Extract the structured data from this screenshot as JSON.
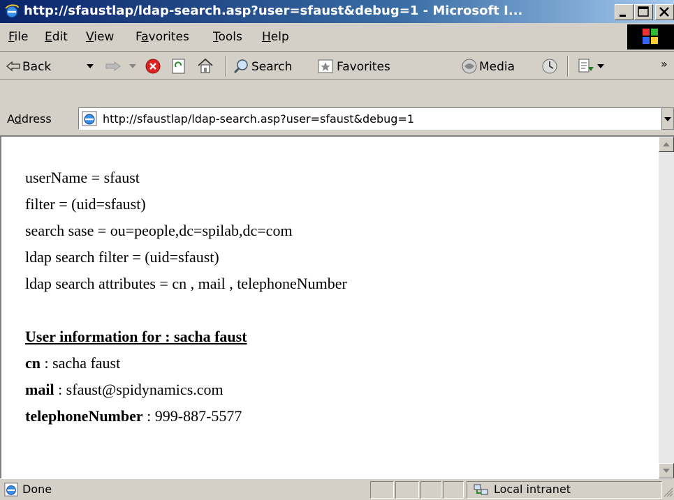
{
  "window": {
    "title": "http://sfaustlap/ldap-search.asp?user=sfaust&debug=1 - Microsoft I..."
  },
  "menu": {
    "file": {
      "pre": "",
      "u": "F",
      "post": "ile"
    },
    "edit": {
      "pre": "",
      "u": "E",
      "post": "dit"
    },
    "view": {
      "pre": "",
      "u": "V",
      "post": "iew"
    },
    "favorites": {
      "pre": "F",
      "u": "a",
      "post": "vorites"
    },
    "tools": {
      "pre": "",
      "u": "T",
      "post": "ools"
    },
    "help": {
      "pre": "",
      "u": "H",
      "post": "elp"
    }
  },
  "toolbar": {
    "back": "Back",
    "search": "Search",
    "favorites": "Favorites",
    "media": "Media",
    "more": "»"
  },
  "address": {
    "label_pre": "A",
    "label_u": "d",
    "label_post": "dress",
    "url": "http://sfaustlap/ldap-search.asp?user=sfaust&debug=1"
  },
  "content": {
    "lines": [
      "userName = sfaust",
      "filter = (uid=sfaust)",
      "search sase = ou=people,dc=spilab,dc=com",
      "ldap search filter = (uid=sfaust)",
      "ldap search attributes = cn , mail , telephoneNumber"
    ],
    "heading": "User information for : sacha faust",
    "attributes": [
      {
        "key": "cn",
        "value": " : sacha faust"
      },
      {
        "key": "mail",
        "value": " : sfaust@spidynamics.com"
      },
      {
        "key": "telephoneNumber",
        "value": " : 999-887-5577"
      }
    ]
  },
  "status": {
    "text": "Done",
    "zone": "Local intranet"
  },
  "colors": {
    "titlebar_start": "#0a246a",
    "titlebar_end": "#a6caf0",
    "chrome": "#d4d0c8"
  }
}
